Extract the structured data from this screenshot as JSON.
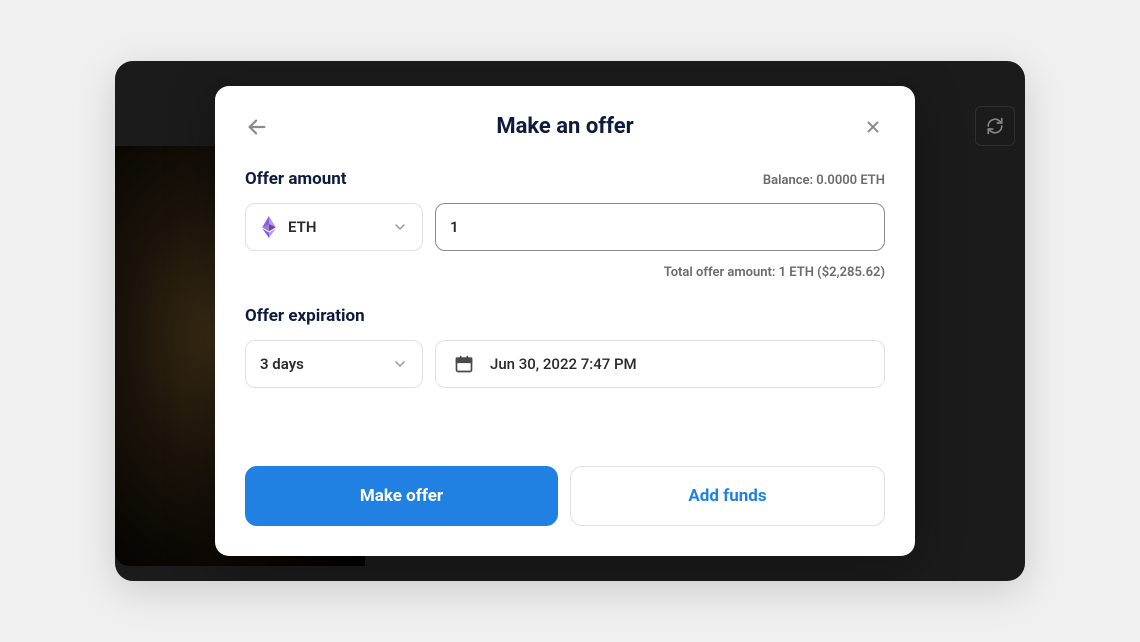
{
  "modal": {
    "title": "Make an offer",
    "offer_amount_label": "Offer amount",
    "balance_label": "Balance: 0.0000 ETH",
    "currency": {
      "symbol": "ETH",
      "icon": "ethereum"
    },
    "amount_value": "1",
    "total_label": "Total offer amount: 1 ETH ($2,285.62)",
    "expiration_label": "Offer expiration",
    "expiration_select_value": "3 days",
    "expiration_date": "Jun 30, 2022 7:47 PM",
    "buttons": {
      "primary": "Make offer",
      "secondary": "Add funds"
    }
  },
  "colors": {
    "primary": "#2081e2",
    "text_dark": "#0d1b3d",
    "text_muted": "#6b6b6b",
    "eth_purple": "#8c5ae8"
  }
}
